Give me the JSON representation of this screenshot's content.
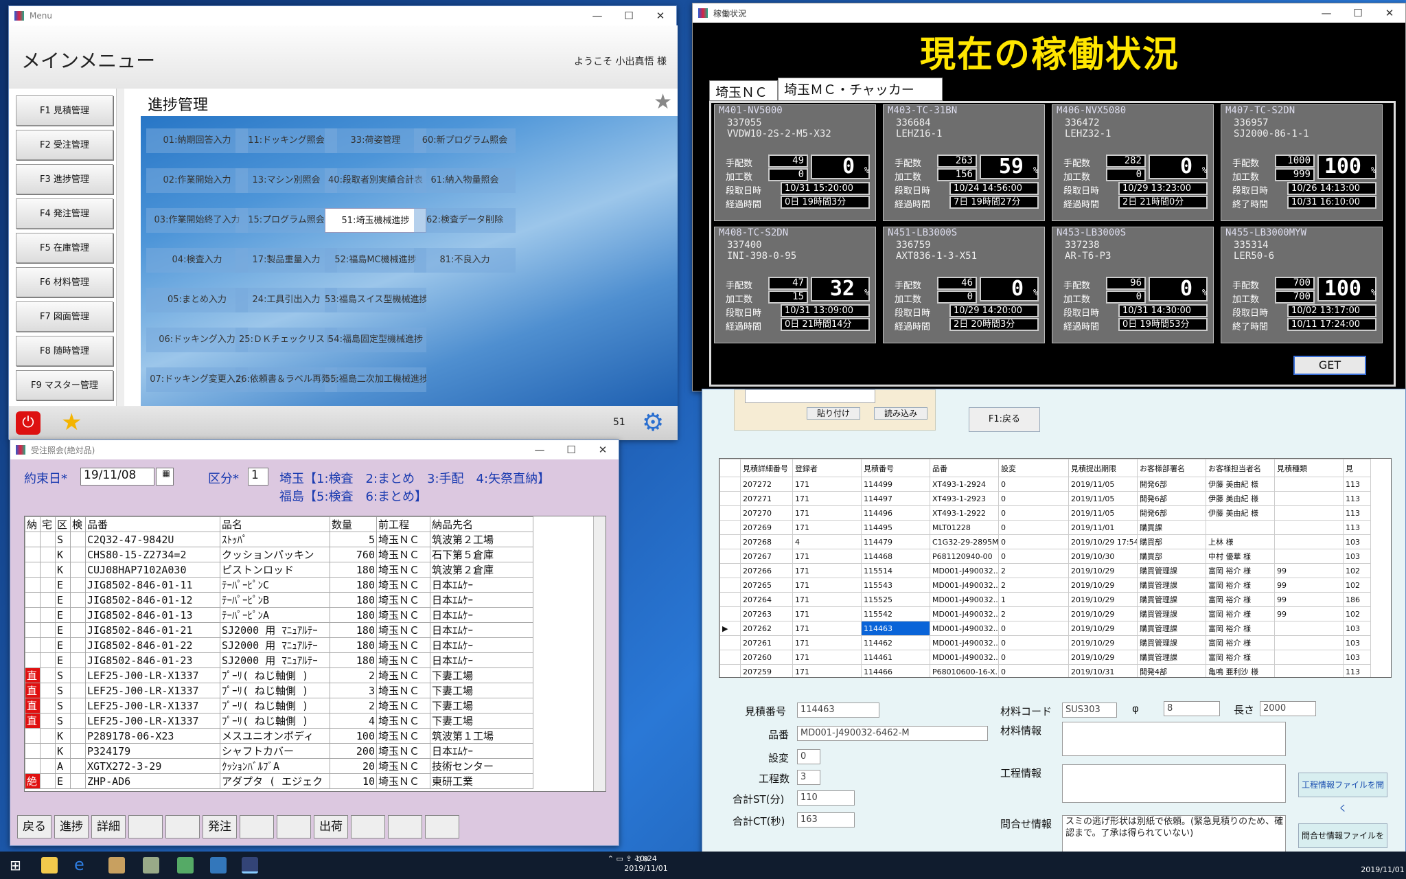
{
  "menu": {
    "window_title": "Menu",
    "title": "メインメニュー",
    "welcome": "ようこそ 小出真悟 様",
    "side": [
      "F1 見積管理",
      "F2 受注管理",
      "F3 進捗管理",
      "F4 発注管理",
      "F5 在庫管理",
      "F6 材料管理",
      "F7 図面管理",
      "F8 随時管理",
      "F9 マスター管理"
    ],
    "section": "進捗管理",
    "buttons": [
      [
        "01:納期回答入力",
        "11:ドッキング照会",
        "33:荷姿管理",
        "60:新プログラム照会"
      ],
      [
        "02:作業開始入力",
        "13:マシン別照会",
        "40:段取者別実績合計表",
        "61:納入物量照会"
      ],
      [
        "03:作業開始終了入力",
        "15:プログラム照会",
        "51:埼玉機械進捗",
        "62:検査データ削除"
      ],
      [
        "04:検査入力",
        "17:製品重量入力",
        "52:福島MC機械進捗",
        "81:不良入力"
      ],
      [
        "05:まとめ入力",
        "24:工具引出入力",
        "53:福島スイス型機械進捗",
        ""
      ],
      [
        "06:ドッキング入力",
        "25:ＤＫチェックリスト",
        "54:福島固定型機械進捗",
        ""
      ],
      [
        "07:ドッキング変更入力",
        "26:依頼書＆ラベル再発行",
        "55:福島二次加工機械進捗",
        ""
      ]
    ],
    "page": "51"
  },
  "status": {
    "window_title": "稼働状況",
    "title": "現在の稼働状況",
    "tabs": [
      "埼玉ＮＣ",
      "埼玉ＭＣ・チャッカー"
    ],
    "get": "GET",
    "labels": {
      "plan": "手配数",
      "done": "加工数",
      "setup": "段取日時",
      "elapsed": "経過時間",
      "end": "終了時間"
    },
    "machines": [
      {
        "id": "M401-NV5000",
        "code": "337055",
        "part": "VVDW10-2S-2-M5-X32",
        "plan": "49",
        "done": "0",
        "pct": "0",
        "d1": "10/31 15:20:00",
        "d2": "0日 19時間3分",
        "mode": "elapsed"
      },
      {
        "id": "M403-TC-31BN",
        "code": "336684",
        "part": "LEHZ16-1",
        "plan": "263",
        "done": "156",
        "pct": "59",
        "d1": "10/24 14:56:00",
        "d2": "7日 19時間27分",
        "mode": "elapsed"
      },
      {
        "id": "M406-NVX5080",
        "code": "336472",
        "part": "LEHZ32-1",
        "plan": "282",
        "done": "0",
        "pct": "0",
        "d1": "10/29 13:23:00",
        "d2": "2日 21時間0分",
        "mode": "elapsed"
      },
      {
        "id": "M407-TC-S2DN",
        "code": "336957",
        "part": "SJ2000-86-1-1",
        "plan": "1000",
        "done": "999",
        "pct": "100",
        "d1": "10/26 14:13:00",
        "d2": "10/31 16:10:00",
        "mode": "end"
      },
      {
        "id": "M408-TC-S2DN",
        "code": "337400",
        "part": "INI-398-0-95",
        "plan": "47",
        "done": "15",
        "pct": "32",
        "d1": "10/31 13:09:00",
        "d2": "0日 21時間14分",
        "mode": "elapsed"
      },
      {
        "id": "N451-LB3000S",
        "code": "336759",
        "part": "AXT836-1-3-X51",
        "plan": "46",
        "done": "0",
        "pct": "0",
        "d1": "10/29 14:20:00",
        "d2": "2日 20時間3分",
        "mode": "elapsed"
      },
      {
        "id": "N453-LB3000S",
        "code": "337238",
        "part": "AR-T6-P3",
        "plan": "96",
        "done": "0",
        "pct": "0",
        "d1": "10/31 14:30:00",
        "d2": "0日 19時間53分",
        "mode": "elapsed"
      },
      {
        "id": "N455-LB3000MYW",
        "code": "335314",
        "part": "LER50-6",
        "plan": "700",
        "done": "700",
        "pct": "100",
        "d1": "10/02 13:17:00",
        "d2": "10/11 17:24:00",
        "mode": "end"
      }
    ]
  },
  "order": {
    "window_title": "受注照会(絶対品)",
    "date_label": "約束日*",
    "date": "19/11/08",
    "kubun_label": "区分*",
    "kubun": "1",
    "legend1": "埼玉【1:検査　2:まとめ　3:手配　4:矢祭直納】",
    "legend2": "福島【5:検査　6:まとめ】",
    "headers": [
      "納",
      "宅",
      "区",
      "検",
      "品番",
      "品名",
      "数量",
      "前工程",
      "納品先名"
    ],
    "rows": [
      [
        "",
        "",
        "S",
        "",
        "C2Q32-47-9842U",
        "ｽﾄｯﾊﾟ",
        "5",
        "埼玉ＮＣ",
        "筑波第２工場"
      ],
      [
        "",
        "",
        "K",
        "",
        "CHS80-15-Z2734=2",
        "クッションパッキン",
        "760",
        "埼玉ＮＣ",
        "石下第５倉庫"
      ],
      [
        "",
        "",
        "K",
        "",
        "CUJ08HAP7102A030",
        "ピストンロッド",
        "180",
        "埼玉ＮＣ",
        "筑波第２倉庫"
      ],
      [
        "",
        "",
        "E",
        "",
        "JIG8502-846-01-11",
        "ﾃｰﾊﾟｰﾋﾟﾝC",
        "180",
        "埼玉ＮＣ",
        "日本ｴﾑｹｰ"
      ],
      [
        "",
        "",
        "E",
        "",
        "JIG8502-846-01-12",
        "ﾃｰﾊﾟｰﾋﾟﾝB",
        "180",
        "埼玉ＮＣ",
        "日本ｴﾑｹｰ"
      ],
      [
        "",
        "",
        "E",
        "",
        "JIG8502-846-01-13",
        "ﾃｰﾊﾟｰﾋﾟﾝA",
        "180",
        "埼玉ＮＣ",
        "日本ｴﾑｹｰ"
      ],
      [
        "",
        "",
        "E",
        "",
        "JIG8502-846-01-21",
        "SJ2000 用 ﾏﾆｭｱﾙﾃｰ",
        "180",
        "埼玉ＮＣ",
        "日本ｴﾑｹｰ"
      ],
      [
        "",
        "",
        "E",
        "",
        "JIG8502-846-01-22",
        "SJ2000 用 ﾏﾆｭｱﾙﾃｰ",
        "180",
        "埼玉ＮＣ",
        "日本ｴﾑｹｰ"
      ],
      [
        "",
        "",
        "E",
        "",
        "JIG8502-846-01-23",
        "SJ2000 用 ﾏﾆｭｱﾙﾃｰ",
        "180",
        "埼玉ＮＣ",
        "日本ｴﾑｹｰ"
      ],
      [
        "直",
        "",
        "S",
        "",
        "LEF25-J00-LR-X1337",
        "ﾌﾟｰﾘ( ねじ軸側 )",
        "2",
        "埼玉ＮＣ",
        "下妻工場"
      ],
      [
        "直",
        "",
        "S",
        "",
        "LEF25-J00-LR-X1337",
        "ﾌﾟｰﾘ( ねじ軸側 )",
        "3",
        "埼玉ＮＣ",
        "下妻工場"
      ],
      [
        "直",
        "",
        "S",
        "",
        "LEF25-J00-LR-X1337",
        "ﾌﾟｰﾘ( ねじ軸側 )",
        "2",
        "埼玉ＮＣ",
        "下妻工場"
      ],
      [
        "直",
        "",
        "S",
        "",
        "LEF25-J00-LR-X1337",
        "ﾌﾟｰﾘ( ねじ軸側 )",
        "4",
        "埼玉ＮＣ",
        "下妻工場"
      ],
      [
        "",
        "",
        "K",
        "",
        "P289178-06-X23",
        "メスユニオンボディ",
        "100",
        "埼玉ＮＣ",
        "筑波第１工場"
      ],
      [
        "",
        "",
        "K",
        "",
        "P324179",
        "シャフトカバー",
        "200",
        "埼玉ＮＣ",
        "日本ｴﾑｹｰ"
      ],
      [
        "",
        "",
        "A",
        "",
        "XGTX272-3-29",
        "ｸｯｼｮﾝﾊﾞﾙﾌﾞA",
        "20",
        "埼玉ＮＣ",
        "技術センター"
      ],
      [
        "絶",
        "",
        "E",
        "",
        "ZHP-AD6",
        "アダプタ ( エジェク",
        "10",
        "埼玉ＮＣ",
        "東研工業"
      ]
    ],
    "buttons": [
      "戻る",
      "進捗",
      "詳細",
      "",
      "",
      "発注",
      "",
      "",
      "出荷",
      "",
      "",
      ""
    ]
  },
  "detail": {
    "paste": "貼り付け",
    "read": "読み込み",
    "back": "F1:戻る",
    "headers": [
      "見積詳細番号",
      "登録者",
      "見積番号",
      "品番",
      "設変",
      "見積提出期限",
      "お客様部署名",
      "お客様担当者名",
      "見積種類",
      "見"
    ],
    "rows": [
      [
        "207272",
        "171",
        "114499",
        "XT493-1-2924",
        "0",
        "2019/11/05",
        "開発6部",
        "伊藤 美由紀 様",
        "",
        "113"
      ],
      [
        "207271",
        "171",
        "114497",
        "XT493-1-2923",
        "0",
        "2019/11/05",
        "開発6部",
        "伊藤 美由紀 様",
        "",
        "113"
      ],
      [
        "207270",
        "171",
        "114496",
        "XT493-1-2922",
        "0",
        "2019/11/05",
        "開発6部",
        "伊藤 美由紀 様",
        "",
        "113"
      ],
      [
        "207269",
        "171",
        "114495",
        "MLT01228",
        "0",
        "2019/11/01",
        "購買課",
        "",
        "",
        "113"
      ],
      [
        "207268",
        "4",
        "114479",
        "C1G32-29-2895M",
        "0",
        "2019/10/29 17:54",
        "購買部",
        "上林 様",
        "",
        "103"
      ],
      [
        "207267",
        "171",
        "114468",
        "P681120940-00",
        "0",
        "2019/10/30",
        "購買部",
        "中村 優華 様",
        "",
        "103"
      ],
      [
        "207266",
        "171",
        "115514",
        "MD001-J490032...",
        "2",
        "2019/10/29",
        "購買管理課",
        "富岡 裕介 様",
        "99",
        "102"
      ],
      [
        "207265",
        "171",
        "115543",
        "MD001-J490032...",
        "2",
        "2019/10/29",
        "購買管理課",
        "富岡 裕介 様",
        "99",
        "102"
      ],
      [
        "207264",
        "171",
        "115525",
        "MD001-J490032...",
        "1",
        "2019/10/29",
        "購買管理課",
        "富岡 裕介 様",
        "99",
        "186"
      ],
      [
        "207263",
        "171",
        "115542",
        "MD001-J490032...",
        "2",
        "2019/10/29",
        "購買管理課",
        "富岡 裕介 様",
        "99",
        "102"
      ],
      [
        "207262",
        "171",
        "114463",
        "MD001-J490032...",
        "0",
        "2019/10/29",
        "購買管理課",
        "富岡 裕介 様",
        "",
        "103"
      ],
      [
        "207261",
        "171",
        "114462",
        "MD001-J490032...",
        "0",
        "2019/10/29",
        "購買管理課",
        "富岡 裕介 様",
        "",
        "103"
      ],
      [
        "207260",
        "171",
        "114461",
        "MD001-J490032...",
        "0",
        "2019/10/29",
        "購買管理課",
        "富岡 裕介 様",
        "",
        "103"
      ],
      [
        "207259",
        "171",
        "114466",
        "P68010600-16-X...",
        "0",
        "2019/10/31",
        "開発4部",
        "亀鳴 亜利沙 様",
        "",
        "113"
      ]
    ],
    "quote_no_label": "見積番号",
    "quote_no": "114463",
    "part_label": "品番",
    "part": "MD001-J490032-6462-M",
    "change_label": "設変",
    "change": "0",
    "proc_label": "工程数",
    "proc": "3",
    "st_label": "合計ST(分)",
    "st": "110",
    "ct_label": "合計CT(秒)",
    "ct": "163",
    "mat_label": "材料コード",
    "mat": "SUS303",
    "phi_label": "φ",
    "phi": "8",
    "len_label": "長さ",
    "len": "2000",
    "matinfo_label": "材料情報",
    "procinfo_label": "工程情報",
    "inq_label": "問合せ情報",
    "inq": "スミの逃げ形状は別紙で依頼。(緊急見積りのため、確認まで。了承は得られていない)",
    "open_proc": "工程情報ファイルを開く",
    "open_inq": "問合せ情報ファイルを開く"
  },
  "taskbar": {
    "time": "10:24",
    "date": "2019/11/01",
    "time2": "2019/11/01"
  }
}
